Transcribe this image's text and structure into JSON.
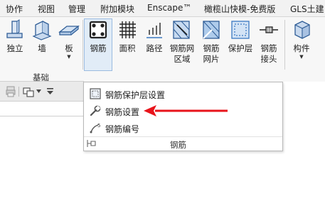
{
  "menubar": {
    "tabs": [
      "协作",
      "视图",
      "管理",
      "附加模块",
      "Enscape™",
      "橄榄山快模-免费版",
      "GLS土建"
    ]
  },
  "ribbon": {
    "tools": [
      {
        "label": "独立",
        "arrow": ""
      },
      {
        "label": "墙",
        "arrow": ""
      },
      {
        "label": "板",
        "arrow": "▼"
      },
      {
        "label": "钢筋",
        "arrow": ""
      },
      {
        "label": "面积",
        "arrow": ""
      },
      {
        "label": "路径",
        "arrow": ""
      },
      {
        "label": "钢筋网\n区域",
        "arrow": ""
      },
      {
        "label": "钢筋\n网片",
        "arrow": ""
      },
      {
        "label": "保护层",
        "arrow": ""
      },
      {
        "label": "钢筋\n接头",
        "arrow": ""
      },
      {
        "label": "构件",
        "arrow": "▼"
      }
    ],
    "group_label": "基础"
  },
  "dropdown": {
    "items": [
      "钢筋保护层设置",
      "钢筋设置",
      "钢筋编号"
    ],
    "footer_label": "钢筋"
  },
  "colors": {
    "annotation_arrow": "#e8141b",
    "icon_blue": "#3a78c2",
    "active_tool_bg": "#e1ecf7"
  }
}
